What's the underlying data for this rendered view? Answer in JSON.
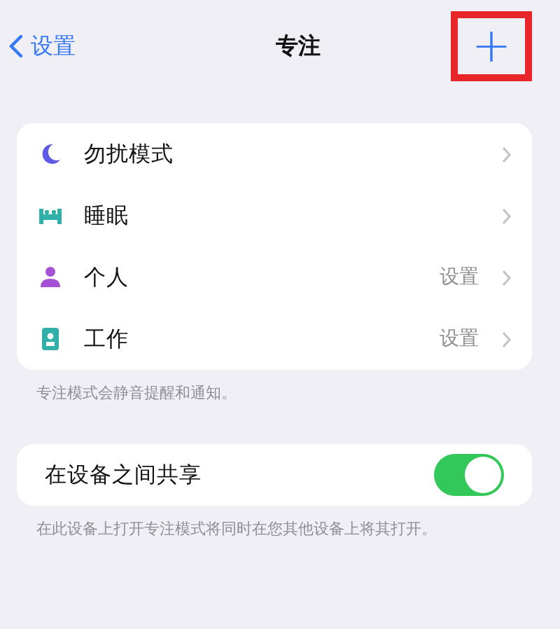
{
  "nav": {
    "back": "设置",
    "title": "专注",
    "add": "+",
    "add_highlighted": true
  },
  "modes": [
    {
      "kind": "moon",
      "label": "勿扰模式"
    },
    {
      "kind": "bed",
      "label": "睡眠"
    },
    {
      "kind": "person",
      "label": "个人",
      "detail": "设置"
    },
    {
      "kind": "badge",
      "label": "工作",
      "detail": "设置"
    }
  ],
  "modes_footer": "专注模式会静音提醒和通知。",
  "share": {
    "label": "在设备之间共享",
    "on": true
  },
  "share_footer": "在此设备上打开专注模式将同时在您其他设备上将其打开。"
}
